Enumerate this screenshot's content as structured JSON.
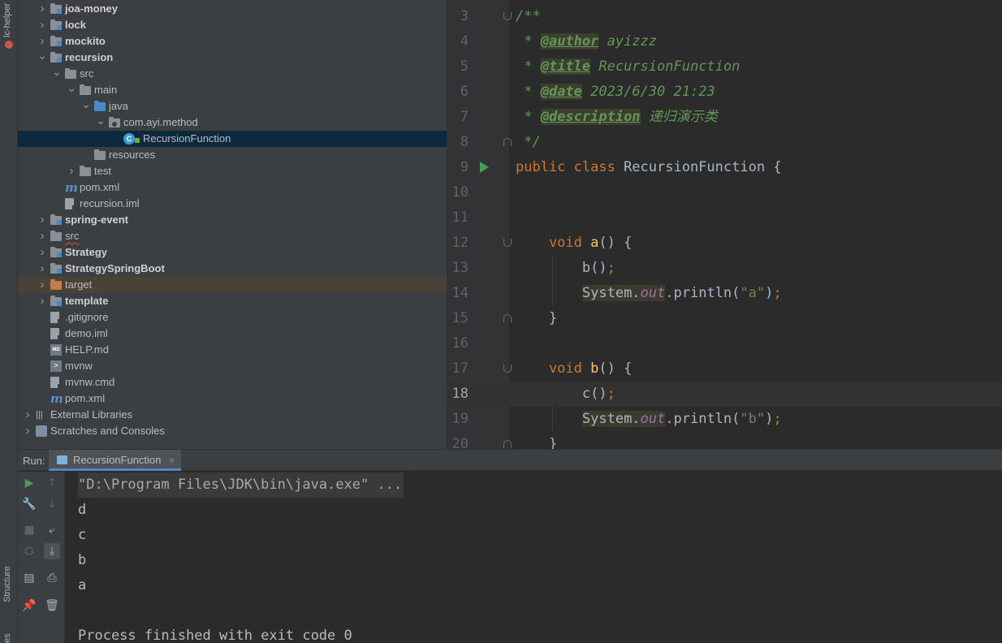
{
  "left_strip": {
    "top_tab": "lc-helper",
    "structure_tab": "Structure",
    "bottom_tab": "es"
  },
  "project_tree": [
    {
      "label": "joa-money",
      "bold": true,
      "level": 1,
      "arrow": "right",
      "icon": "module-folder"
    },
    {
      "label": "lock",
      "bold": true,
      "level": 1,
      "arrow": "right",
      "icon": "module-folder"
    },
    {
      "label": "mockito",
      "bold": true,
      "level": 1,
      "arrow": "right",
      "icon": "module-folder"
    },
    {
      "label": "recursion",
      "bold": true,
      "level": 1,
      "arrow": "down",
      "icon": "module-folder"
    },
    {
      "label": "src",
      "level": 2,
      "arrow": "down",
      "icon": "folder"
    },
    {
      "label": "main",
      "level": 3,
      "arrow": "down",
      "icon": "folder"
    },
    {
      "label": "java",
      "level": 4,
      "arrow": "down",
      "icon": "source-folder"
    },
    {
      "label": "com.ayi.method",
      "level": 5,
      "arrow": "down",
      "icon": "package"
    },
    {
      "label": "RecursionFunction",
      "level": 6,
      "arrow": "none",
      "icon": "class",
      "selected": true
    },
    {
      "label": "resources",
      "level": 4,
      "arrow": "none",
      "icon": "folder"
    },
    {
      "label": "test",
      "level": 3,
      "arrow": "right",
      "icon": "folder"
    },
    {
      "label": "pom.xml",
      "level": 2,
      "arrow": "none",
      "icon": "maven"
    },
    {
      "label": "recursion.iml",
      "level": 2,
      "arrow": "none",
      "icon": "file"
    },
    {
      "label": "spring-event",
      "bold": true,
      "level": 1,
      "arrow": "right",
      "icon": "module-folder"
    },
    {
      "label": "src",
      "level": 1,
      "arrow": "right",
      "icon": "folder",
      "error": true
    },
    {
      "label": "Strategy",
      "bold": true,
      "level": 1,
      "arrow": "right",
      "icon": "module-folder"
    },
    {
      "label": "StrategySpringBoot",
      "bold": true,
      "level": 1,
      "arrow": "right",
      "icon": "module-folder"
    },
    {
      "label": "target",
      "level": 1,
      "arrow": "right",
      "icon": "excluded-folder",
      "highlight": true
    },
    {
      "label": "template",
      "bold": true,
      "level": 1,
      "arrow": "right",
      "icon": "module-folder"
    },
    {
      "label": ".gitignore",
      "level": 1,
      "arrow": "none",
      "icon": "file"
    },
    {
      "label": "demo.iml",
      "level": 1,
      "arrow": "none",
      "icon": "file"
    },
    {
      "label": "HELP.md",
      "level": 1,
      "arrow": "none",
      "icon": "markdown"
    },
    {
      "label": "mvnw",
      "level": 1,
      "arrow": "none",
      "icon": "terminal"
    },
    {
      "label": "mvnw.cmd",
      "level": 1,
      "arrow": "none",
      "icon": "file"
    },
    {
      "label": "pom.xml",
      "level": 1,
      "arrow": "none",
      "icon": "maven"
    },
    {
      "label": "External Libraries",
      "level": 0,
      "arrow": "right",
      "icon": "library"
    },
    {
      "label": "Scratches and Consoles",
      "level": 0,
      "arrow": "right",
      "icon": "scratch"
    }
  ],
  "editor": {
    "current_line": 18,
    "lines": [
      {
        "n": "3",
        "fold": "open",
        "tokens": [
          {
            "t": "/**",
            "c": "doc"
          }
        ]
      },
      {
        "n": "4",
        "tokens": [
          {
            "t": " * ",
            "c": "doc"
          },
          {
            "t": "@author",
            "c": "doc-tag"
          },
          {
            "t": " ayizzz",
            "c": "doc"
          }
        ]
      },
      {
        "n": "5",
        "tokens": [
          {
            "t": " * ",
            "c": "doc"
          },
          {
            "t": "@title",
            "c": "doc-tag"
          },
          {
            "t": " RecursionFunction",
            "c": "doc"
          }
        ]
      },
      {
        "n": "6",
        "tokens": [
          {
            "t": " * ",
            "c": "doc"
          },
          {
            "t": "@date",
            "c": "doc-tag"
          },
          {
            "t": " 2023/6/30 21:23",
            "c": "doc"
          }
        ]
      },
      {
        "n": "7",
        "tokens": [
          {
            "t": " * ",
            "c": "doc"
          },
          {
            "t": "@description",
            "c": "doc-tag"
          },
          {
            "t": " 递归演示类",
            "c": "doc"
          }
        ]
      },
      {
        "n": "8",
        "fold": "close",
        "tokens": [
          {
            "t": " */",
            "c": "doc"
          }
        ]
      },
      {
        "n": "9",
        "run": true,
        "tokens": [
          {
            "t": "public class ",
            "c": "kw"
          },
          {
            "t": "RecursionFunction {",
            "c": "plain"
          }
        ]
      },
      {
        "n": "10",
        "tokens": []
      },
      {
        "n": "11",
        "tokens": []
      },
      {
        "n": "12",
        "fold": "open",
        "tokens": [
          {
            "t": "    void ",
            "c": "kw"
          },
          {
            "t": "a",
            "c": "fn"
          },
          {
            "t": "() {",
            "c": "plain"
          }
        ]
      },
      {
        "n": "13",
        "tokens": [
          {
            "t": "        b()",
            "c": "plain"
          },
          {
            "t": ";",
            "c": "kw"
          }
        ]
      },
      {
        "n": "14",
        "tokens": [
          {
            "t": "        ",
            "c": "plain"
          },
          {
            "t": "System.",
            "c": "plain hl"
          },
          {
            "t": "out",
            "c": "field hl"
          },
          {
            "t": ".println(",
            "c": "plain"
          },
          {
            "t": "\"a\"",
            "c": "str"
          },
          {
            "t": ")",
            "c": "plain"
          },
          {
            "t": ";",
            "c": "kw"
          }
        ]
      },
      {
        "n": "15",
        "fold": "close",
        "tokens": [
          {
            "t": "    }",
            "c": "plain"
          }
        ]
      },
      {
        "n": "16",
        "tokens": []
      },
      {
        "n": "17",
        "fold": "open",
        "tokens": [
          {
            "t": "    void ",
            "c": "kw"
          },
          {
            "t": "b",
            "c": "fn"
          },
          {
            "t": "() {",
            "c": "plain"
          }
        ]
      },
      {
        "n": "18",
        "tokens": [
          {
            "t": "        c()",
            "c": "plain"
          },
          {
            "t": ";",
            "c": "kw"
          }
        ]
      },
      {
        "n": "19",
        "tokens": [
          {
            "t": "        ",
            "c": "plain"
          },
          {
            "t": "System.",
            "c": "plain hl"
          },
          {
            "t": "out",
            "c": "field hl"
          },
          {
            "t": ".println(",
            "c": "plain"
          },
          {
            "t": "\"b\"",
            "c": "str"
          },
          {
            "t": ")",
            "c": "plain"
          },
          {
            "t": ";",
            "c": "kw"
          }
        ]
      },
      {
        "n": "20",
        "fold": "close",
        "tokens": [
          {
            "t": "    }",
            "c": "plain"
          }
        ]
      }
    ]
  },
  "run_panel": {
    "label": "Run:",
    "tab_label": "RecursionFunction",
    "tab_close": "×",
    "toolbar_left": [
      {
        "name": "rerun-icon",
        "glyph": "▶",
        "color": "#499c54"
      },
      {
        "name": "wrench-icon",
        "glyph": "🔧"
      },
      {
        "name": "stop-icon",
        "glyph": "■",
        "dim": true
      },
      {
        "name": "dump-threads-icon",
        "glyph": "⛭",
        "dim": true
      },
      {
        "name": "layout-icon",
        "glyph": "▤"
      },
      {
        "name": "pin-icon",
        "glyph": "📌"
      }
    ],
    "toolbar_right": [
      {
        "name": "up-icon",
        "glyph": "↑",
        "dim": true
      },
      {
        "name": "down-icon",
        "glyph": "↓",
        "dim": true
      },
      {
        "name": "soft-wrap-icon",
        "glyph": "⤶"
      },
      {
        "name": "scroll-to-end-icon",
        "glyph": "⤓",
        "active": true
      },
      {
        "name": "print-icon",
        "glyph": "⎙"
      },
      {
        "name": "trash-icon",
        "glyph": "🗑"
      }
    ],
    "output": [
      "\"D:\\Program Files\\JDK\\bin\\java.exe\" ...",
      "d",
      "c",
      "b",
      "a",
      "",
      "Process finished with exit code 0"
    ]
  },
  "colors": {
    "keyword": "#cc7832",
    "method": "#ffc66d",
    "doc_comment": "#629755",
    "string": "#6a8759",
    "field": "#9876aa",
    "selection": "#0d293e"
  }
}
